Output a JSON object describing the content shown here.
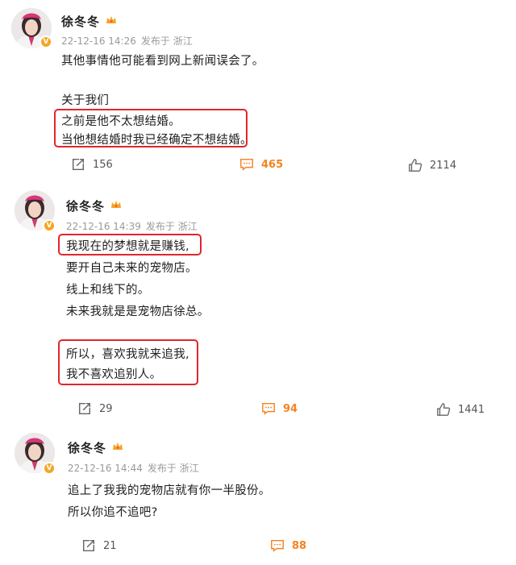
{
  "colors": {
    "accent": "#f58220",
    "highlight": "#e0262b",
    "meta": "#9a9a9a",
    "verified": "#f5a623"
  },
  "posts": [
    {
      "author": "徐冬冬",
      "time": "22-12-16 14:26",
      "location": "发布于 浙江",
      "lines": [
        "其他事情他可能看到网上新闻误会了。",
        "关于我们",
        "之前是他不太想结婚。",
        "当他想结婚时我已经确定不想结婚。"
      ],
      "reposts": "156",
      "comments": "465",
      "likes": "2114"
    },
    {
      "author": "徐冬冬",
      "time": "22-12-16 14:39",
      "location": "发布于 浙江",
      "lines": [
        "我现在的梦想就是赚钱,",
        "要开自己未来的宠物店。",
        "线上和线下的。",
        "未来我就是是宠物店徐总。",
        "所以，喜欢我就来追我,",
        "我不喜欢追别人。"
      ],
      "reposts": "29",
      "comments": "94",
      "likes": "1441"
    },
    {
      "author": "徐冬冬",
      "time": "22-12-16 14:44",
      "location": "发布于 浙江",
      "lines": [
        "追上了我我的宠物店就有你一半股份。",
        "所以你追不追吧?"
      ],
      "reposts": "21",
      "comments": "88"
    }
  ],
  "icons": {
    "repost": "repost-icon",
    "comment": "comment-icon",
    "like": "like-icon",
    "verified": "verified-badge-icon",
    "crown": "vip-crown-icon"
  }
}
